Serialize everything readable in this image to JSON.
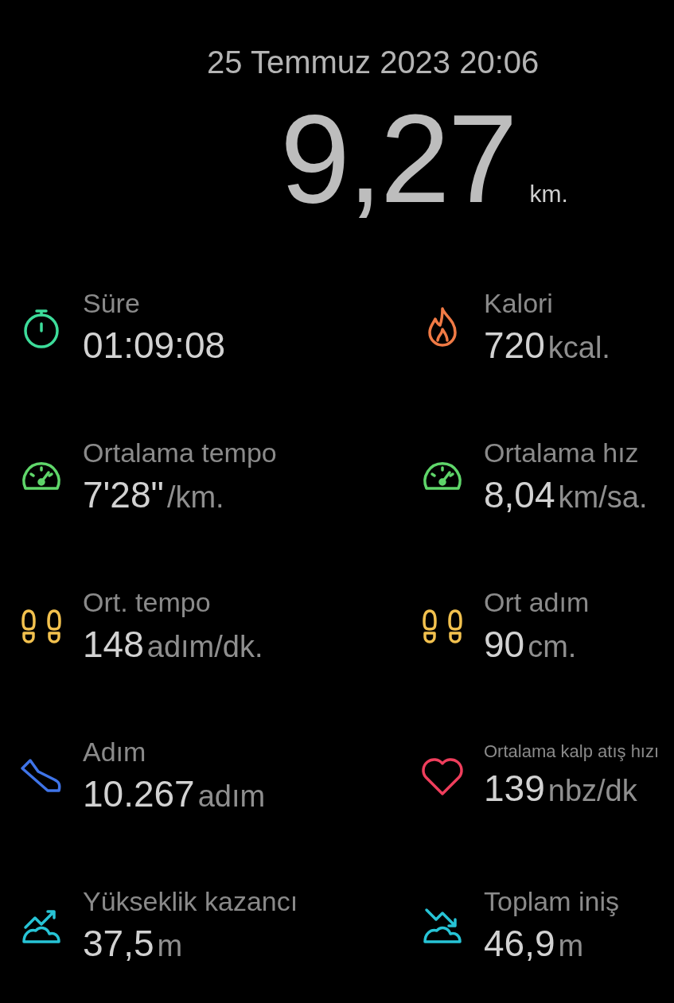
{
  "header": {
    "datetime": "25 Temmuz 2023 20:06",
    "distance": "9,27",
    "distance_unit": "km."
  },
  "stats": [
    {
      "kind": "stopwatch",
      "color": "#3ddc9a",
      "label": "Süre",
      "value": "01:09:08"
    },
    {
      "kind": "flame",
      "color": "#f07a45",
      "label": "Kalori",
      "value": "720",
      "unit": "kcal."
    },
    {
      "kind": "gauge",
      "color": "#5fd66a",
      "label": "Ortalama tempo",
      "value": "7'28\"",
      "unit": "/km."
    },
    {
      "kind": "gauge",
      "color": "#5fd66a",
      "label": "Ortalama hız",
      "value": "8,04",
      "unit": "km/sa."
    },
    {
      "kind": "footprints",
      "color": "#f2c14e",
      "label": "Ort. tempo",
      "value": "148",
      "unit": "adım/dk."
    },
    {
      "kind": "footprints",
      "color": "#f2c14e",
      "label": "Ort adım",
      "value": "90",
      "unit": "cm."
    },
    {
      "kind": "shoe",
      "color": "#3f74e8",
      "label": "Adım",
      "value": "10.267",
      "unit": "adım"
    },
    {
      "kind": "heart",
      "color": "#ef3e5c",
      "label": "Ortalama kalp atış hızı",
      "value": "139",
      "unit": "nbz/dk"
    },
    {
      "kind": "climb",
      "color": "#27c4d6",
      "label": "Yükseklik kazancı",
      "value": "37,5",
      "unit": "m"
    },
    {
      "kind": "descent",
      "color": "#27c4d6",
      "label": "Toplam iniş",
      "value": "46,9",
      "unit": "m"
    }
  ]
}
